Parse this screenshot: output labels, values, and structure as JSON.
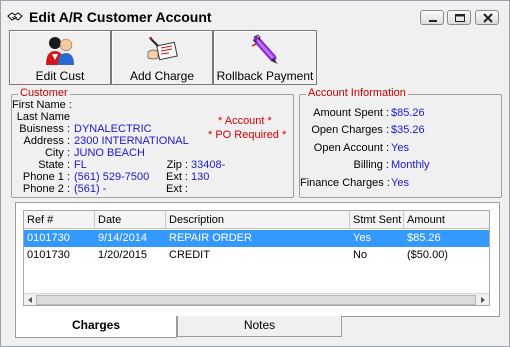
{
  "window": {
    "title": "Edit A/R Customer Account"
  },
  "toolbar": {
    "edit_cust": "Edit Cust",
    "add_charge": "Add Charge",
    "rollback_payment": "Rollback Payment"
  },
  "customer": {
    "group_title": "Customer",
    "labels": {
      "first_name": "First Name :",
      "last_name": "Last Name",
      "business": "Buisness :",
      "address": "Address :",
      "city": "City :",
      "state": "State :",
      "zip": "Zip :",
      "phone1": "Phone 1 :",
      "ext1": "Ext :",
      "phone2": "Phone 2 :",
      "ext2": "Ext :"
    },
    "first_name": "",
    "last_name": "",
    "business": "DYNALECTRIC",
    "address": "2300 INTERNATIONAL",
    "city": "JUNO BEACH",
    "state": "FL",
    "zip": "33408-",
    "phone1": "(561) 529-7500",
    "ext1": "130",
    "phone2": "(561)    -",
    "ext2": "",
    "account_required": "* Account *",
    "po_required": "* PO Required *"
  },
  "account": {
    "group_title": "Account Information",
    "labels": {
      "amount_spent": "Amount Spent :",
      "open_charges": "Open Charges :",
      "open_account": "Open Account :",
      "billing": "Billing :",
      "finance_charges": "Finance Charges :"
    },
    "amount_spent": "$85.26",
    "open_charges": "$35.26",
    "open_account": "Yes",
    "billing": "Monthly",
    "finance_charges": "Yes"
  },
  "charges_table": {
    "columns": [
      "Ref #",
      "Date",
      "Description",
      "Stmt Sent",
      "Amount"
    ],
    "rows": [
      {
        "ref": "0101730",
        "date": "9/14/2014",
        "description": "REPAIR ORDER",
        "stmt_sent": "Yes",
        "amount": "$85.26",
        "selected": true
      },
      {
        "ref": "0101730",
        "date": "1/20/2015",
        "description": "CREDIT",
        "stmt_sent": "No",
        "amount": "($50.00)",
        "selected": false
      }
    ]
  },
  "tabs": {
    "charges": "Charges",
    "notes": "Notes"
  },
  "colors": {
    "value_blue": "#1a1ac8",
    "label_red": "#d00000",
    "selection": "#3399ff"
  },
  "icons": {
    "title": "handshake-icon",
    "edit_cust": "people-icon",
    "add_charge": "invoice-hand-icon",
    "rollback_payment": "pen-icon"
  }
}
